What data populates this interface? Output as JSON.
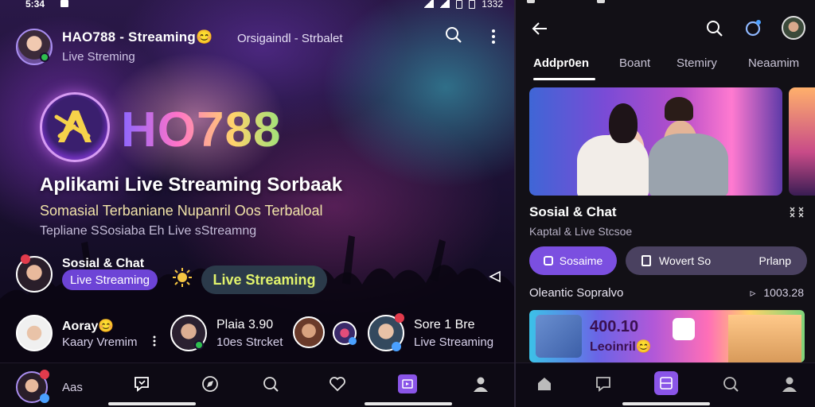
{
  "left": {
    "status": {
      "time": "5:34",
      "right_text": "1332"
    },
    "header": {
      "title": "HAO788 - Streaming😊",
      "subtitle": "Live Streming",
      "mid_text": "Orsigaindl - Strbalet"
    },
    "brand": {
      "logo_text": "HO788",
      "tagline": "Aplikami Live Streaming Sorbaak",
      "subline1": "Somasial Terbaniane Nupanril Oos Terbaloal",
      "subline2": "Tepliane SSosiaba Eh Live sStreamng"
    },
    "row1": {
      "name": "Sosial & Chat",
      "badge": "Live Streaming",
      "button": "Live Streaming"
    },
    "row2": [
      {
        "name": "Aoray😊",
        "sub": "Kaary Vremim"
      },
      {
        "name": "Plaia 3.90",
        "sub": "10es Strcket"
      },
      {
        "name": "Sore 1 Bre",
        "sub": "Live Streaming"
      }
    ],
    "bottom_nav": {
      "label": "Aas"
    }
  },
  "right": {
    "tabs": [
      "Addpr0en",
      "Boant",
      "Stemiry",
      "Neaamim"
    ],
    "card": {
      "title": "Sosial & Chat",
      "subtitle": "Kaptal & Live Stcsoe"
    },
    "pills": {
      "primary": "Sosaime",
      "secondary": "Wovert So",
      "secondary_right": "Prlanp"
    },
    "section": {
      "title": "Oleantic Sopralvo",
      "right": "1003.28"
    },
    "promo": {
      "title": "400.10",
      "subtitle": "Leoinril😊"
    }
  },
  "colors": {
    "accent": "#7b4fe0",
    "pill_green": "#d8f26a",
    "nav_active": "#8a55e8"
  }
}
